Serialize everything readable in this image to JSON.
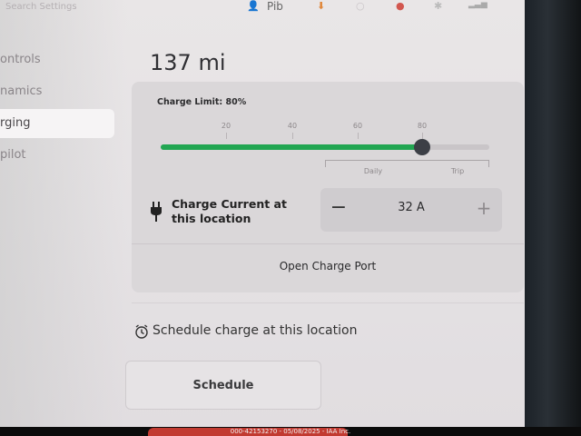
{
  "status_bar": {
    "breadcrumb": "Search Settings",
    "user_name": "Pib",
    "icons": [
      "user-icon",
      "download-icon",
      "bell-icon",
      "bluetooth-icon",
      "signal-icon"
    ]
  },
  "sidebar": {
    "items": [
      {
        "label": "ontrols"
      },
      {
        "label": "namics"
      },
      {
        "label": "rging",
        "active": true
      },
      {
        "label": "pilot"
      }
    ]
  },
  "range": "137 mi",
  "charge": {
    "limit_label": "Charge Limit: 80%",
    "limit_percent": 80,
    "ticks": [
      "20",
      "40",
      "60",
      "80"
    ],
    "zones": {
      "daily": "Daily",
      "trip": "Trip"
    },
    "accent_color": "#22a652",
    "current": {
      "label_line1": "Charge Current at",
      "label_line2": "this location",
      "minus": "−",
      "value": "32 A",
      "plus": "+"
    },
    "open_port_label": "Open Charge Port"
  },
  "schedule": {
    "label": "Schedule charge at this location",
    "button_label": "Schedule"
  },
  "watermark": "000-42153270 - 05/08/2025 - IAA Inc."
}
